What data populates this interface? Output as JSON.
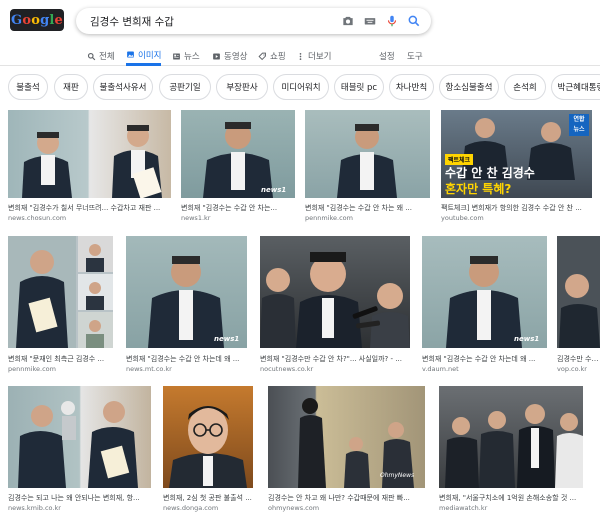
{
  "header": {
    "logo_text": "Google",
    "query": "김경수 변희재 수갑"
  },
  "tabs": [
    {
      "label": "전체",
      "icon": "search-icon"
    },
    {
      "label": "이미지",
      "icon": "image-icon",
      "active": true
    },
    {
      "label": "뉴스",
      "icon": "news-icon"
    },
    {
      "label": "동영상",
      "icon": "video-icon"
    },
    {
      "label": "쇼핑",
      "icon": "tag-icon"
    },
    {
      "label": "더보기",
      "icon": "more-icon"
    }
  ],
  "settings_label": "설정",
  "tools_label": "도구",
  "chips": [
    "불출석",
    "재판",
    "불출석사유서",
    "공판기일",
    "부장판사",
    "미디어워치",
    "태블릿 pc",
    "차나반칙",
    "항소심불출석",
    "손석희",
    "박근혜대통령"
  ],
  "results": [
    {
      "caption": "변희재 \"김경수가 칠서 무너뜨려... 수갑차고 재판 ...",
      "source": "news.chosun.com"
    },
    {
      "caption": "변희재 \"김경수는 수갑 안 차는...",
      "source": "news1.kr"
    },
    {
      "caption": "변희재 \"김경수는 수갑 안 차는 왜 ...",
      "source": "pennmike.com"
    },
    {
      "caption": "팩트체크] 변희재가 항의한 김경수 수갑 안 찬 ...",
      "source": "youtube.com"
    },
    {
      "caption": "변희재 \"문재인 최측근 김경수 ...",
      "source": "pennmike.com"
    },
    {
      "caption": "변희재 \"김경수는 수갑 안 차는데 왜 ...",
      "source": "news.mt.co.kr"
    },
    {
      "caption": "변희재 \"김경수만 수갑 안 차?\"... 사실일까? - ...",
      "source": "nocutnews.co.kr"
    },
    {
      "caption": "변희재 \"김경수는 수갑 안 차는데 왜 ...",
      "source": "v.daum.net"
    },
    {
      "caption": "김경수만 수갑 ...",
      "source": "vop.co.kr"
    },
    {
      "caption": "김경수는 되고 나는 왜 안되나는 변희재, 항...",
      "source": "news.kmib.co.kr"
    },
    {
      "caption": "변희재, 2심 첫 공판 불출석 ...",
      "source": "news.donga.com"
    },
    {
      "caption": "김경수는 안 차고 왜 나만? 수갑때문에 재판 빠...",
      "source": "ohmynews.com"
    },
    {
      "caption": "변희재, \"서울구치소에 1억원 손해소송할 것 ...",
      "source": "mediawatch.kr"
    }
  ],
  "overlays": {
    "factcheck_tag": "팩트체크",
    "factcheck_line1": "수갑 안 찬 김경수",
    "factcheck_line2": "혼자만 특혜?",
    "yonhap_line1": "연합",
    "yonhap_line2": "뉴스",
    "news1_mark": "news1",
    "ohmynews_mark": "OhmyNews"
  },
  "colors": {
    "accent": "#1a73e8",
    "factcheck_yellow": "#ffd400",
    "yonhap_blue": "#1565c0"
  }
}
